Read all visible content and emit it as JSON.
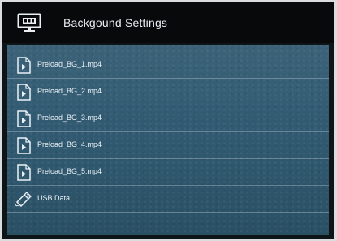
{
  "header": {
    "title": "Backgound Settings",
    "icon": "monitor-icon"
  },
  "files": [
    {
      "label": "Preload_BG_1.mp4",
      "icon": "video-file-icon"
    },
    {
      "label": "Preload_BG_2.mp4",
      "icon": "video-file-icon"
    },
    {
      "label": "Preload_BG_3.mp4",
      "icon": "video-file-icon"
    },
    {
      "label": "Preload_BG_4.mp4",
      "icon": "video-file-icon"
    },
    {
      "label": "Preload_BG_5.mp4",
      "icon": "video-file-icon"
    }
  ],
  "usb": {
    "label": "USB Data",
    "icon": "usb-icon"
  },
  "colors": {
    "header_bg": "#07090b",
    "panel_bg": "#315a72",
    "text": "#eaf2f7"
  }
}
